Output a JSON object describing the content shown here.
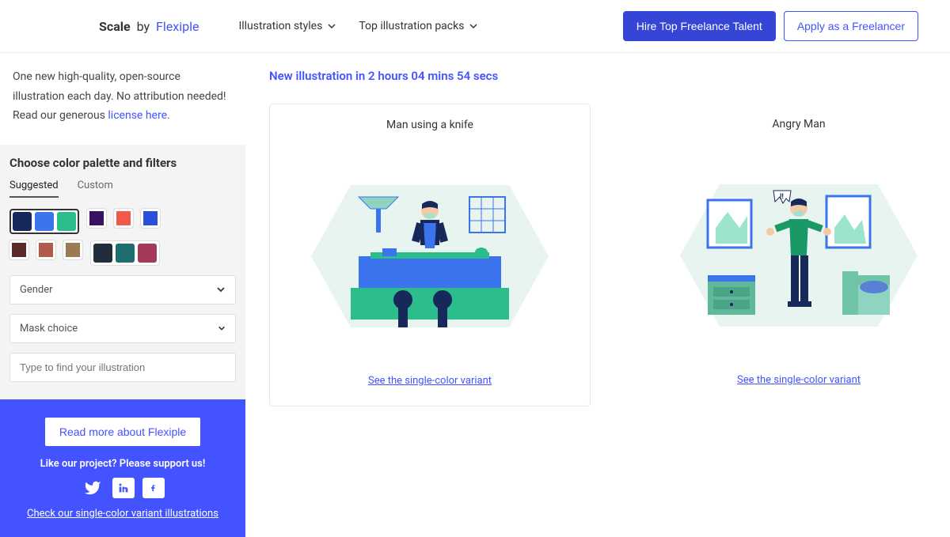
{
  "header": {
    "brand_scale": "Scale",
    "brand_by": "by",
    "brand_flexiple": "Flexiple",
    "nav": [
      "Illustration styles",
      "Top illustration packs"
    ],
    "hire_btn": "Hire Top Freelance Talent",
    "apply_btn": "Apply as a Freelancer"
  },
  "sidebar": {
    "intro_parts": {
      "pre": "One new high-quality, open-source illustration each day. No attribution needed! Read our generous ",
      "link": "license here",
      "post": "."
    },
    "filter_title": "Choose color palette and filters",
    "tabs": {
      "suggested": "Suggested",
      "custom": "Custom"
    },
    "palettes": {
      "row1_group1": [
        "#16295a",
        "#3b74ed",
        "#2bbd8c"
      ],
      "row1_individual": [
        "#3b1263",
        "#f15a4a",
        "#2a4fd8"
      ],
      "row2_individual": [
        "#5a2929",
        "#b35a4a",
        "#9c7a4f"
      ],
      "row2_group2": [
        "#1f2d3d",
        "#1e6e6e",
        "#a43a5a"
      ]
    },
    "gender_label": "Gender",
    "mask_label": "Mask choice",
    "search_placeholder": "Type to find your illustration"
  },
  "promo": {
    "read_more": "Read more about Flexiple",
    "support": "Like our project? Please support us!",
    "check_link": "Check our single-color variant illustrations"
  },
  "main": {
    "countdown_prefix": "New illustration in ",
    "countdown_time": "2 hours 04 mins 54 secs",
    "cards": [
      {
        "title": "Man using a knife",
        "variant": "See the single-color variant"
      },
      {
        "title": "Angry Man",
        "variant": "See the single-color variant"
      }
    ]
  }
}
